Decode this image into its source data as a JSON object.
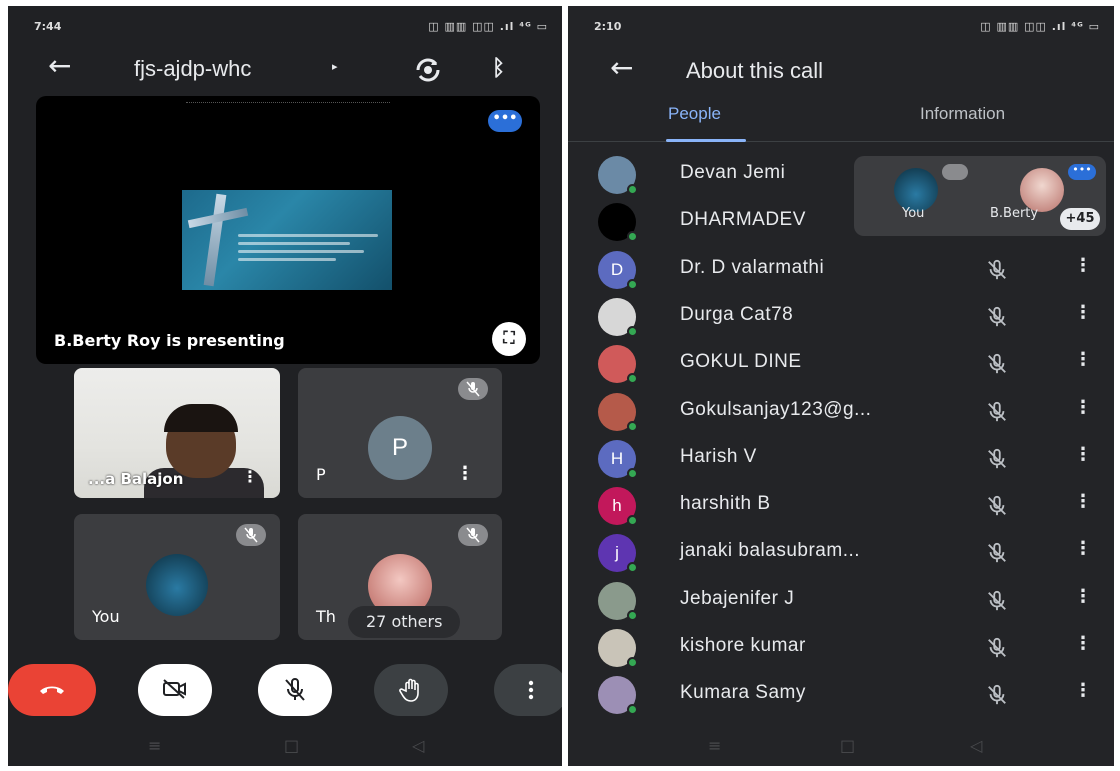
{
  "left_screen": {
    "status": {
      "time": "7:44",
      "right_icons": "◫ ▥▥ ◫◫ .ıl ⁴ᴳ ▭"
    },
    "header": {
      "title": "fjs-ajdp-whc",
      "caret": "▸"
    },
    "presentation": {
      "label": "B.Berty Roy is presenting",
      "more_label": "•••"
    },
    "tiles": {
      "camera": {
        "name": "...a Balajon"
      },
      "p": {
        "initial": "P",
        "name": "P"
      },
      "you": {
        "name": "You"
      },
      "th": {
        "name": "Th"
      }
    },
    "others": "27 others",
    "colors": {
      "end_call": "#ea4335",
      "accent": "#2b6fd8",
      "p_avatar": "#6c7f8b"
    }
  },
  "right_screen": {
    "status": {
      "time": "2:10",
      "right_icons": "◫ ▥▥ ◫◫ .ıl ⁴ᴳ ▭"
    },
    "header": {
      "title": "About this call"
    },
    "tabs": [
      {
        "label": "People"
      },
      {
        "label": "Information"
      }
    ],
    "pip": {
      "you_label": "You",
      "berty_label": "B.Berty",
      "count": "+45"
    },
    "people": [
      {
        "name": "Devan Jemi",
        "initial": "",
        "color": "#6b8aa6"
      },
      {
        "name": "DHARMADEV",
        "initial": "",
        "color": "#000000"
      },
      {
        "name": "Dr. D valarmathi",
        "initial": "D",
        "color": "#5c6bc0"
      },
      {
        "name": "Durga Cat78",
        "initial": "",
        "color": "#d7d7d7"
      },
      {
        "name": "GOKUL DINE",
        "initial": "",
        "color": "#d05a5a"
      },
      {
        "name": "Gokulsanjay123@g...",
        "initial": "",
        "color": "#b55a4a"
      },
      {
        "name": "Harish V",
        "initial": "H",
        "color": "#5c6bc0"
      },
      {
        "name": "harshith B",
        "initial": "h",
        "color": "#c2185b"
      },
      {
        "name": "janaki balasubram...",
        "initial": "j",
        "color": "#5e35b1"
      },
      {
        "name": "Jebajenifer J",
        "initial": "",
        "color": "#8a9a8c"
      },
      {
        "name": "kishore kumar",
        "initial": "",
        "color": "#c9c4b8"
      },
      {
        "name": "Kumara Samy",
        "initial": "",
        "color": "#9c8fb5"
      }
    ]
  }
}
